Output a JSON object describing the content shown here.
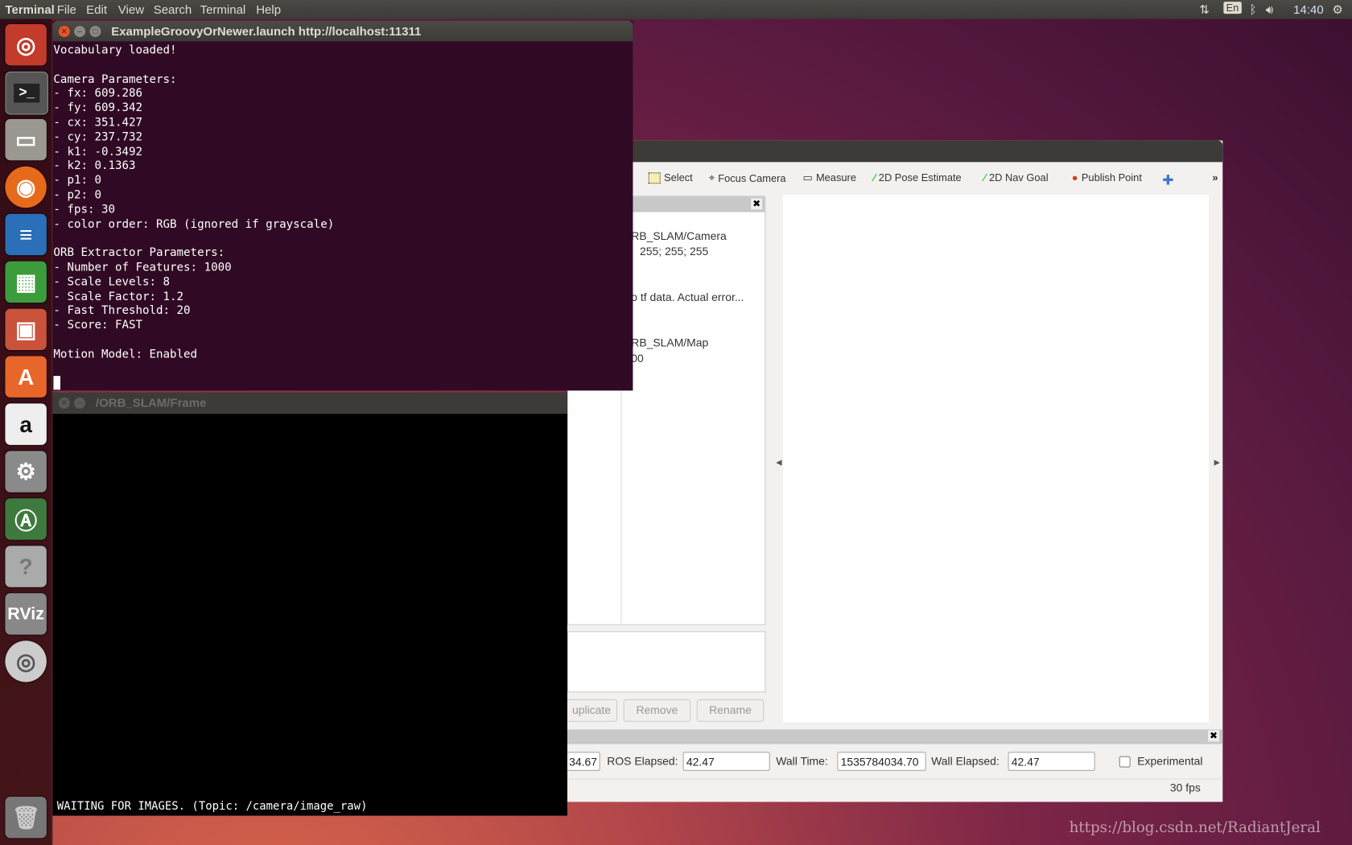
{
  "top_panel": {
    "app_name": "Terminal",
    "menus": [
      "File",
      "Edit",
      "View",
      "Search",
      "Terminal",
      "Help"
    ],
    "keyboard_layout": "En",
    "clock": "14:40"
  },
  "launcher": {
    "items": [
      "ubuntu-dash",
      "terminal",
      "files",
      "firefox",
      "libreoffice-writer",
      "libreoffice-calc",
      "libreoffice-impress",
      "software-center",
      "amazon",
      "system-settings",
      "software-updater",
      "help",
      "rviz",
      "dvd"
    ],
    "rviz_label": "RViz"
  },
  "terminal": {
    "title": "ExampleGroovyOrNewer.launch http://localhost:11311",
    "lines": [
      "Vocabulary loaded!",
      "",
      "Camera Parameters:",
      "- fx: 609.286",
      "- fy: 609.342",
      "- cx: 351.427",
      "- cy: 237.732",
      "- k1: -0.3492",
      "- k2: 0.1363",
      "- p1: 0",
      "- p2: 0",
      "- fps: 30",
      "- color order: RGB (ignored if grayscale)",
      "",
      "ORB Extractor Parameters:",
      "- Number of Features: 1000",
      "- Scale Levels: 8",
      "- Scale Factor: 1.2",
      "- Fast Threshold: 20",
      "- Score: FAST",
      "",
      "Motion Model: Enabled"
    ]
  },
  "frame_window": {
    "title": "/ORB_SLAM/Frame",
    "status": "WAITING FOR IMAGES. (Topic: /camera/image_raw)"
  },
  "rviz": {
    "toolbar": [
      "Select",
      "Focus Camera",
      "Measure",
      "2D Pose Estimate",
      "2D Nav Goal",
      "Publish Point"
    ],
    "displays": {
      "camera_topic": "RB_SLAM/Camera",
      "color": "255; 255; 255",
      "error": "o tf data.  Actual error...",
      "map_topic": "RB_SLAM/Map",
      "partial_value": "00"
    },
    "buttons": [
      "uplicate",
      "Remove",
      "Rename"
    ],
    "time": {
      "ros_time_partial": "34.67",
      "ros_elapsed_label": "ROS Elapsed:",
      "ros_elapsed": "42.47",
      "wall_time_label": "Wall Time:",
      "wall_time": "1535784034.70",
      "wall_elapsed_label": "Wall Elapsed:",
      "wall_elapsed": "42.47",
      "experimental_label": "Experimental",
      "experimental_checked": false
    },
    "fps": "30 fps"
  },
  "watermark": "https://blog.csdn.net/RadiantJeral"
}
